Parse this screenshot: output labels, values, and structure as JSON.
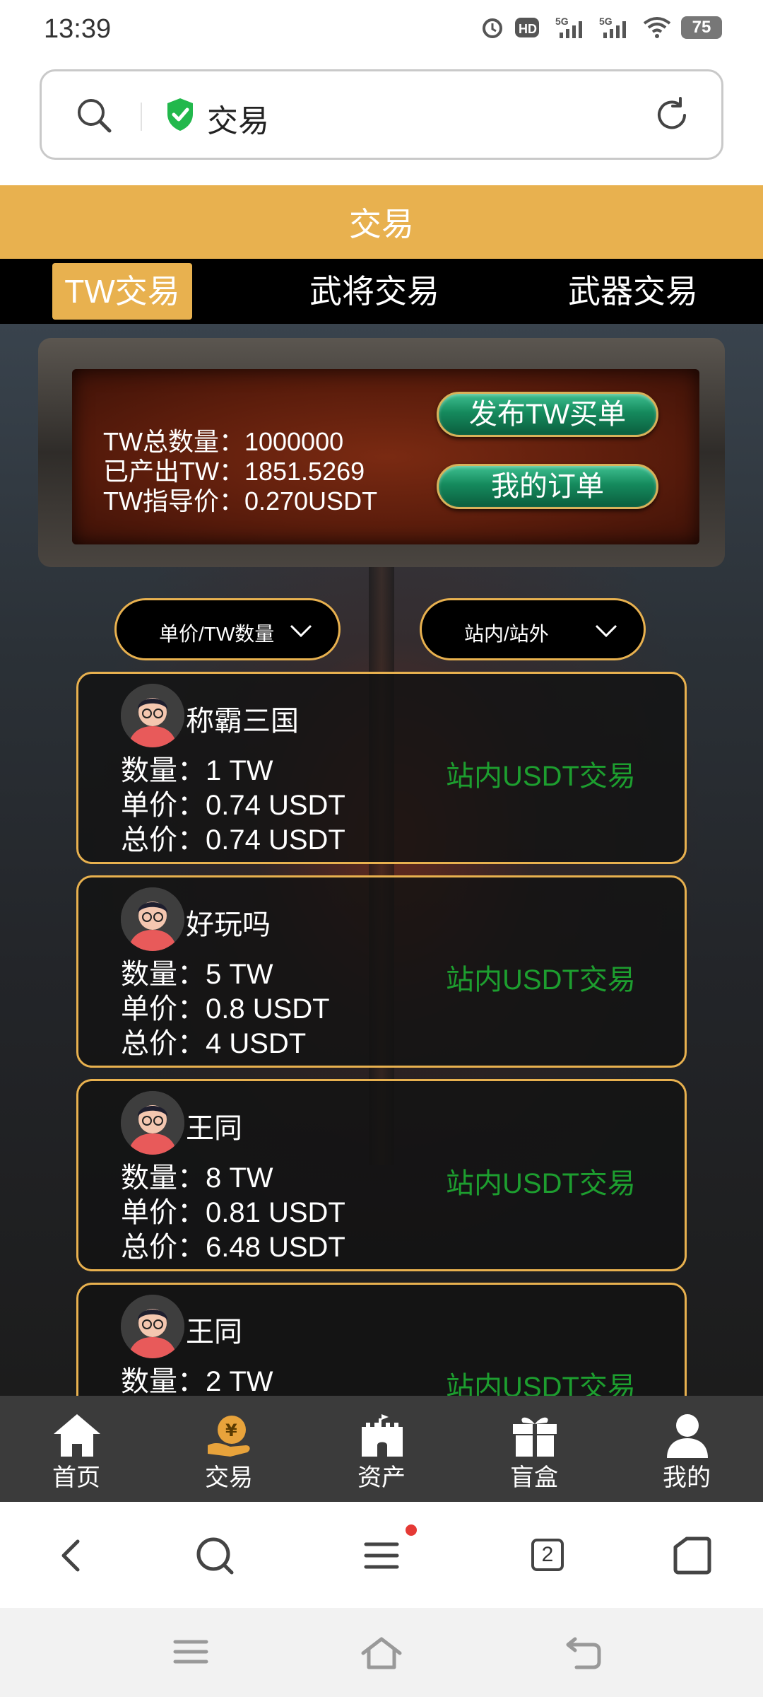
{
  "status_bar": {
    "time": "13:39",
    "signal_label_1": "5G",
    "signal_label_2": "5G",
    "battery": "75",
    "icons": [
      "alarm-icon",
      "hd-icon",
      "signal-5g-icon",
      "signal-5g-icon",
      "wifi-icon",
      "battery-icon"
    ]
  },
  "browser": {
    "url_text": "交易",
    "icons": [
      "search-icon",
      "shield-check-icon",
      "refresh-icon"
    ]
  },
  "header": {
    "title": "交易"
  },
  "tabs": [
    {
      "label": "TW交易",
      "active": true
    },
    {
      "label": "武将交易",
      "active": false
    },
    {
      "label": "武器交易",
      "active": false
    }
  ],
  "info_panel": {
    "total_line": "TW总数量：1000000",
    "produced_line": "已产出TW：1851.5269",
    "guide_price_line": "TW指导价：0.270USDT",
    "publish_button": "发布TW买单",
    "orders_button": "我的订单"
  },
  "filters": {
    "sort_label": "单价/TW数量",
    "scope_label": "站内/站外"
  },
  "listings": [
    {
      "seller": "称霸三国",
      "quantity": "数量：1 TW",
      "price": "单价：0.74 USDT",
      "total": "总价：0.74 USDT",
      "trade_type": "站内USDT交易"
    },
    {
      "seller": "好玩吗",
      "quantity": "数量：5 TW",
      "price": "单价：0.8 USDT",
      "total": "总价：4 USDT",
      "trade_type": "站内USDT交易"
    },
    {
      "seller": "王同",
      "quantity": "数量：8 TW",
      "price": "单价：0.81 USDT",
      "total": "总价：6.48 USDT",
      "trade_type": "站内USDT交易"
    },
    {
      "seller": "王同",
      "quantity": "数量：2 TW",
      "price": "",
      "total": "",
      "trade_type": "站内USDT交易"
    }
  ],
  "bottom_nav": [
    {
      "label": "首页",
      "icon": "home-icon"
    },
    {
      "label": "交易",
      "icon": "trade-coin-icon"
    },
    {
      "label": "资产",
      "icon": "castle-icon"
    },
    {
      "label": "盲盒",
      "icon": "gift-icon"
    },
    {
      "label": "我的",
      "icon": "user-icon"
    }
  ],
  "browser_toolbar": {
    "tab_count": "2",
    "icons": [
      "back-icon",
      "search-icon",
      "menu-icon",
      "tabs-icon",
      "home-icon"
    ]
  },
  "colors": {
    "accent": "#e8b14f",
    "trade_green": "#1d9e2f",
    "panel_button_green": "#158a5d"
  }
}
